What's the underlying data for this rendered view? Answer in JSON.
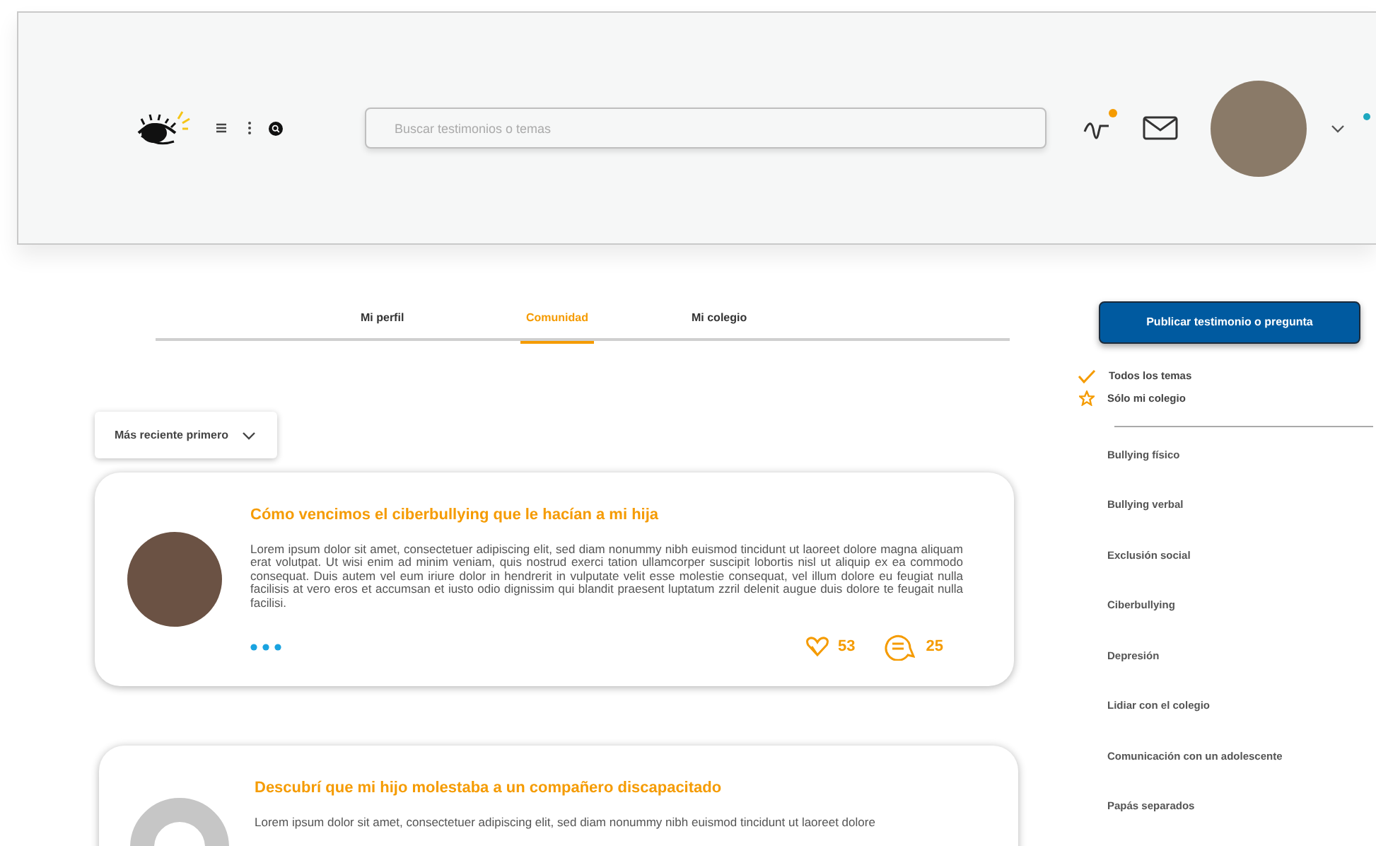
{
  "header": {
    "search": {
      "placeholder": "Buscar testimonios o temas"
    },
    "notification_dot": true
  },
  "tabs": [
    {
      "label": "Mi perfil",
      "selected": false
    },
    {
      "label": "Comunidad",
      "selected": true
    },
    {
      "label": "Mi colegio",
      "selected": false
    }
  ],
  "sort": {
    "value": "Más reciente primero"
  },
  "posts": [
    {
      "title": "Cómo vencimos el ciberbullying que le hacían a mi hija",
      "body": "Lorem ipsum dolor sit amet, consectetuer adipiscing elit, sed diam nonummy nibh euismod tincidunt ut laoreet dolore magna aliquam erat volutpat. Ut wisi enim ad minim veniam, quis nostrud exerci tation ullamcorper suscipit lobortis nisl ut aliquip ex ea commodo consequat. Duis autem vel eum iriure dolor in hendrerit in vulputate velit esse molestie consequat, vel illum dolore eu feugiat nulla facilisis at vero eros et accumsan et iusto odio dignissim qui blandit praesent luptatum zzril delenit augue duis dolore te feugait nulla facilisi.",
      "kind": "photo",
      "likes": "53",
      "comments": "25"
    },
    {
      "title": "Descubrí que mi hijo molestaba a un compañero discapacitado",
      "body": "Lorem ipsum dolor sit amet, consectetuer adipiscing elit, sed diam nonummy nibh euismod tincidunt ut laoreet dolore",
      "kind": "silhouette"
    }
  ],
  "sidebar": {
    "publish_button": "Publicar testimonio o pregunta",
    "filters": [
      {
        "kind": "check",
        "label": "Todos los temas"
      },
      {
        "kind": "star",
        "label": "Sólo mi colegio"
      }
    ],
    "topics": [
      "Bullying físico",
      "Bullying verbal",
      "Exclusión social",
      "Ciberbullying",
      "Depresión",
      "Lidiar con el colegio",
      "Comunicación con un adolescente",
      "Papás separados"
    ]
  }
}
